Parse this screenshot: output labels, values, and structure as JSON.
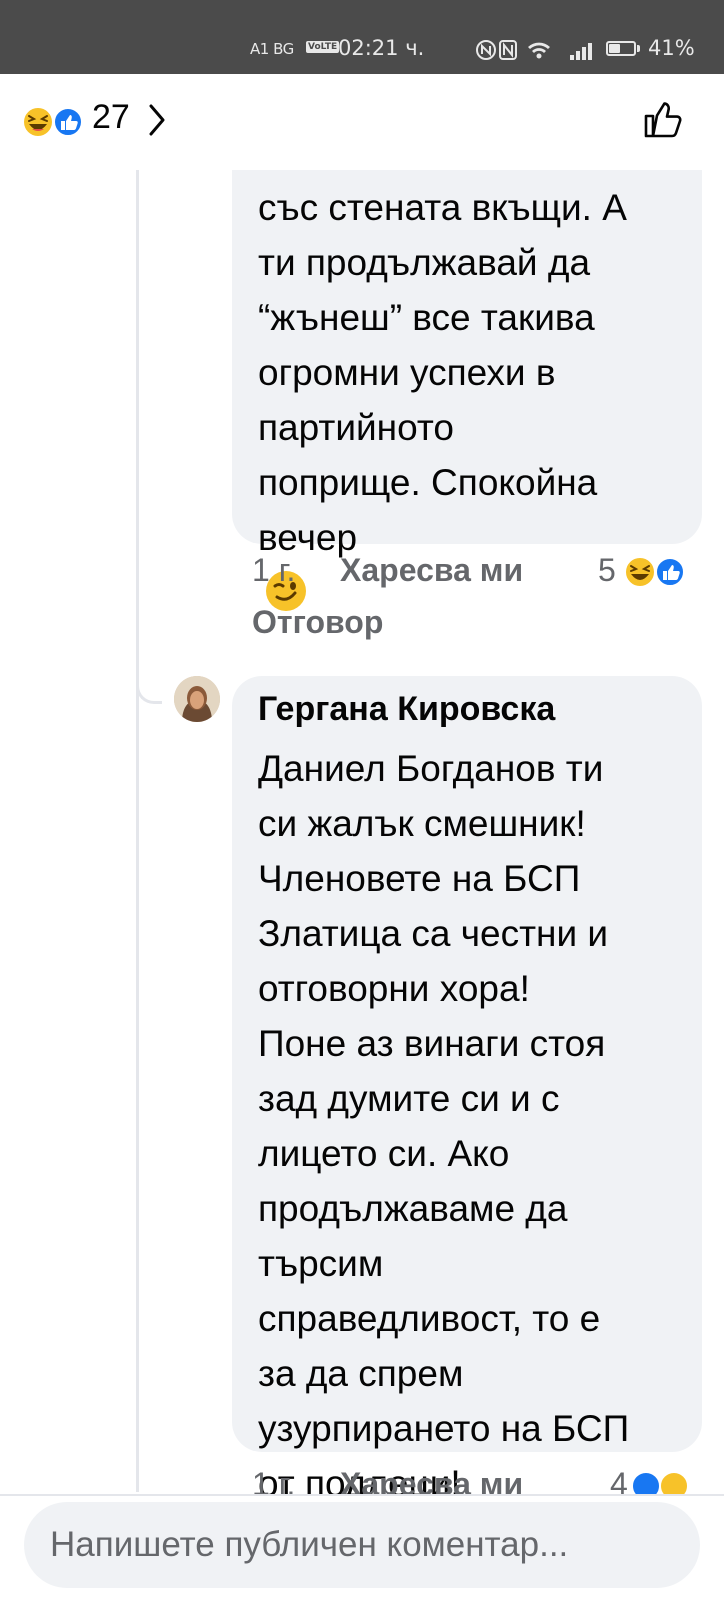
{
  "status_bar": {
    "carrier": "A1 BG",
    "volte": "VoLTE",
    "time": "02:21 ч.",
    "battery": "41%"
  },
  "header": {
    "reaction_count": "27",
    "reaction_icons": [
      "laugh-emoji-icon",
      "like-emoji-icon"
    ],
    "like_icon": "thumbs-up-outline-icon"
  },
  "comments": [
    {
      "text": "със стената вкъщи. А\nти продължавай да\n“жънеш” все такива\nогромни успехи в\nпартийното\nпоприще. Спокойна\nвечер",
      "emoji": "wink-emoji-icon",
      "time": "1 г.",
      "like_label": "Харесва ми",
      "reply_label": "Отговор",
      "reaction_count": "5"
    },
    {
      "author": "Гергана Кировска",
      "text": "Даниел Богданов ти\nси жалък смешник!\nЧленовете на БСП\nЗлатица са честни и\nотговорни хора!\nПоне аз винаги стоя\nзад думите си и с\nлицето си. Ако\nпродължаваме да\nтърсим\nсправедливост, то е\nза да спрем\nузурпирането на БСП\nот подлеци!",
      "time": "1 г.",
      "like_label": "Харесва ми",
      "reaction_count": "4"
    }
  ],
  "composer": {
    "placeholder": "Напишете публичен коментар..."
  },
  "colors": {
    "bubble": "#f0f2f5",
    "meta": "#65676b",
    "facebook_blue": "#1877f2",
    "status_bar": "#4b4b4b"
  }
}
